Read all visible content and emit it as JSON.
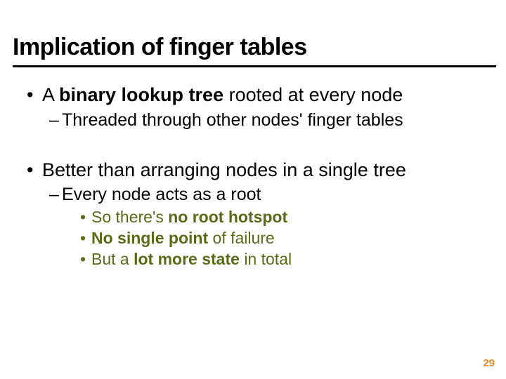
{
  "title": "Implication of finger tables",
  "b1_pre": "A ",
  "b1_bold": "binary lookup tree",
  "b1_post": " rooted at every node",
  "b1_sub": "Threaded through other nodes' finger tables",
  "b2": "Better than arranging nodes in a single tree",
  "b2_sub": "Every node acts as a root",
  "c1_pre": "So there's ",
  "c1_bold": "no root hotspot",
  "c2_bold": "No single point",
  "c2_post": " of failure",
  "c3_pre": "But a ",
  "c3_bold": "lot more state",
  "c3_post": " in total",
  "page": "29"
}
